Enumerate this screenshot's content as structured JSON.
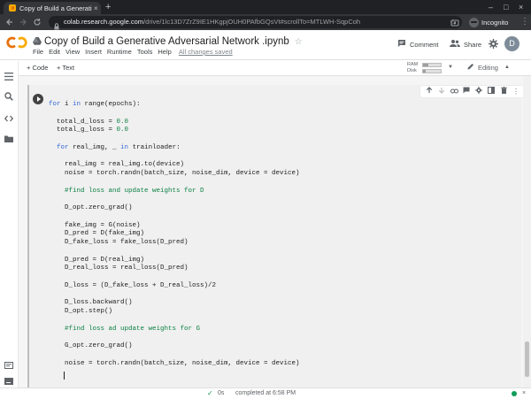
{
  "browser": {
    "tab_title": "Copy of Build a Generative",
    "tab_close": "×",
    "new_tab": "+",
    "window_controls": [
      "–",
      "□",
      "×"
    ],
    "url_host": "colab.research.google.com",
    "url_path": "/drive/1lc13D7ZrZ9IE1HKgpjOUH0PAfbGQsVt#scrollTo=MTLWH-SqpCoh",
    "incognito_label": "Incognito"
  },
  "header": {
    "doc_title": "Copy of Build a Generative Adversarial Network .ipynb",
    "menu": [
      "File",
      "Edit",
      "View",
      "Insert",
      "Runtime",
      "Tools",
      "Help"
    ],
    "save_status": "All changes saved",
    "comment_label": "Comment",
    "share_label": "Share",
    "avatar_initial": "D"
  },
  "toolbar": {
    "add_code": "+ Code",
    "add_text": "+ Text",
    "ram_label": "RAM",
    "disk_label": "Disk",
    "ram_level": 0.3,
    "disk_level": 0.15,
    "editing_label": "Editing"
  },
  "code_lines": [
    "for i in range(epochs):",
    "",
    "  total_d_loss = 0.0",
    "  total_g_loss = 0.0",
    "",
    "  for real_img, _ in trainloader:",
    "",
    "    real_img = real_img.to(device)",
    "    noise = torch.randn(batch_size, noise_dim, device = device)",
    "",
    "    #find loss and update weights for D",
    "",
    "    D_opt.zero_grad()",
    "",
    "    fake_img = G(noise)",
    "    D_pred = D(fake_img)",
    "    D_fake_loss = fake_loss(D_pred)",
    "",
    "    D_pred = D(real_img)",
    "    D_real_loss = real_loss(D_pred)",
    "",
    "    D_loss = (D_fake_loss + D_real_loss)/2",
    "",
    "    D_loss.backward()",
    "    D_opt.step()",
    "",
    "    #find loss ad update weights for G",
    "",
    "    G_opt.zero_grad()",
    "",
    "    noise = torch.randn(batch_size, noise_dim, device = device)"
  ],
  "status": {
    "check": "✓",
    "duration": "0s",
    "message": "completed at 6:58 PM",
    "close": "×"
  },
  "colors": {
    "chrome_dark": "#202124",
    "colab_orange": "#f9ab00",
    "keyword_blue": "#3367d6",
    "comment_green": "#0b8043",
    "status_green": "#0f9d58"
  }
}
